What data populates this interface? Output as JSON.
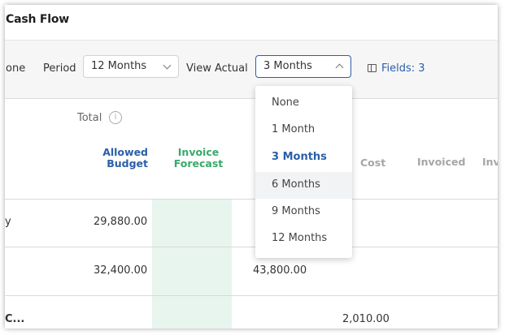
{
  "header": {
    "title": "Cash Flow"
  },
  "toolbar": {
    "cut_label": "one",
    "period_label": "Period",
    "period_value": "12 Months",
    "view_actual_label": "View Actual",
    "view_actual_value": "3 Months",
    "fields_label": "Fields: 3"
  },
  "columns": {
    "total_label": "Total",
    "info_icon": "i",
    "allowed_budget": [
      "Allowed",
      "Budget"
    ],
    "invoice_forecast": [
      "Invoice",
      "Forecast"
    ],
    "cost": "Cost",
    "invoiced": "Invoiced",
    "cut_col": "Inv"
  },
  "rows": [
    {
      "name": "y",
      "allowed_budget": "29,880.00",
      "forecast_col": "",
      "cost": ""
    },
    {
      "name": "",
      "allowed_budget": "32,400.00",
      "forecast_col": "43,800.00",
      "cost": ""
    },
    {
      "name": "C...",
      "allowed_budget": "",
      "forecast_col": "",
      "cost": "2,010.00"
    }
  ],
  "dropdown": {
    "options": [
      "None",
      "1 Month",
      "3 Months",
      "6 Months",
      "9 Months",
      "12 Months"
    ],
    "selected": "3 Months",
    "hovered": "6 Months"
  },
  "colors": {
    "accent": "#2a5fa8",
    "invoice_forecast": "#3aa86b",
    "forecast_column_bg": "#e7f5ee"
  }
}
